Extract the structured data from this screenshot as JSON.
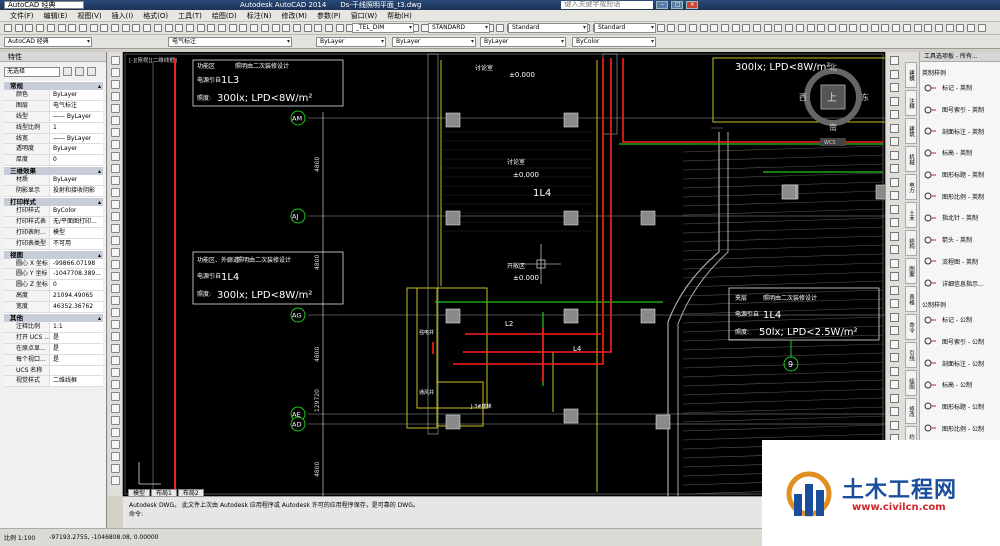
{
  "window": {
    "workspace": "AutoCAD 经典",
    "app_title": "Autodesk AutoCAD 2014",
    "file_title": "Ds-干线照明平面_t3.dwg",
    "search_placeholder": "键入关键字或短语"
  },
  "menu": [
    "文件(F)",
    "编辑(E)",
    "视图(V)",
    "插入(I)",
    "格式(O)",
    "工具(T)",
    "绘图(D)",
    "标注(N)",
    "修改(M)",
    "参数(P)",
    "窗口(W)",
    "帮助(H)"
  ],
  "toolbar": {
    "workspace_combo": "AutoCAD 经典",
    "layer_combo": "电气标注",
    "bylayer_combo": "ByLayer",
    "linetype_combo": "ByLayer",
    "lineweight_combo": "ByLayer",
    "plotstyle_combo": "ByColor",
    "dimstyle_combo": "_TEL_DIM",
    "textstyle_combo": "STANDARD",
    "tablestyle_combo": "Standard",
    "mleader_combo": "Standard"
  },
  "properties": {
    "title": "特性",
    "selection": "无选择",
    "sections": [
      {
        "name": "常规",
        "rows": [
          [
            "颜色",
            "ByLayer"
          ],
          [
            "图层",
            "电气标注"
          ],
          [
            "线型",
            "—— ByLayer"
          ],
          [
            "线型比例",
            "1"
          ],
          [
            "线宽",
            "—— ByLayer"
          ],
          [
            "透明度",
            "ByLayer"
          ],
          [
            "厚度",
            "0"
          ]
        ]
      },
      {
        "name": "三维效果",
        "rows": [
          [
            "材质",
            "ByLayer"
          ],
          [
            "阴影显示",
            "投射和接收阴影"
          ]
        ]
      },
      {
        "name": "打印样式",
        "rows": [
          [
            "打印样式",
            "ByColor"
          ],
          [
            "打印样式表",
            "无/平面图打印..."
          ],
          [
            "打印表附...",
            "模型"
          ],
          [
            "打印表类型",
            "不可用"
          ]
        ]
      },
      {
        "name": "视图",
        "rows": [
          [
            "圆心 X 坐标",
            "-99866.07198"
          ],
          [
            "圆心 Y 坐标",
            "-1047708.389..."
          ],
          [
            "圆心 Z 坐标",
            "0"
          ],
          [
            "高度",
            "21094.49065"
          ],
          [
            "宽度",
            "46352.36762"
          ]
        ]
      },
      {
        "name": "其他",
        "rows": [
          [
            "注释比例",
            "1:1"
          ],
          [
            "打开 UCS ...",
            "是"
          ],
          [
            "在原点显...",
            "是"
          ],
          [
            "每个视口...",
            "是"
          ],
          [
            "UCS 名称",
            ""
          ],
          [
            "视觉样式",
            "二维线框"
          ]
        ]
      }
    ]
  },
  "drawing": {
    "viewport_label": "[-][俯视][二维线框]",
    "axes": [
      "AM",
      "AJ",
      "AG",
      "AE",
      "AD"
    ],
    "dims": [
      "4800",
      "4800",
      "4800",
      "129720",
      "4800"
    ],
    "notes": {
      "block1": {
        "l1": "功能区",
        "l2": "照明由二次装修设计",
        "l3": "电源引自",
        "l4": "1L3",
        "l5": "照度:",
        "l6": "300lx; LPD<8W/m²"
      },
      "block2": {
        "l1": "功能区、外廊道",
        "l2": "照明由二次装修设计",
        "l3": "电源引自",
        "l4": "1L4",
        "l5": "照度:",
        "l6": "300lx; LPD<8W/m²"
      },
      "block3": {
        "l1": "夹层",
        "l2": "照明由二次装修设计",
        "l3": "电源引自",
        "l4": "1L4",
        "l5": "照度:",
        "l6": "50lx; LPD<2.5W/m²"
      },
      "top_right": "300lx; LPD<8W/m²"
    },
    "elevations": [
      "讨论室",
      "±0.000",
      "讨论室",
      "±0.000",
      "开敞区",
      "±0.000"
    ],
    "labels": {
      "circuit1": "1L4",
      "l2": "L2",
      "l4": "L4",
      "room1": "强电井",
      "room2": "通风井",
      "room3": "J-3#楼梯"
    },
    "compass": {
      "n": "北",
      "s": "南",
      "e": "东",
      "w": "西",
      "center": "上"
    },
    "wcs": "WCS",
    "axis_9": "9"
  },
  "tabs": [
    "模型",
    "布局1",
    "布局2"
  ],
  "command": {
    "line1": "Autodesk DWG。 此文件上次由 Autodesk 应用程序或 Autodesk 许可的应用程序保存，是可靠的 DWG。",
    "prompt": "命令:"
  },
  "status": {
    "scale": "比例 1:100",
    "coords": "-97193.2755, -1046808.08, 0.00000"
  },
  "palette": {
    "title": "工具选项板 - 所有...",
    "section1": "英制样例",
    "items1": [
      "标记 - 英制",
      "图号索引 - 英制",
      "剖面标注 - 英制",
      "标高 - 英制",
      "图形标题 - 英制",
      "图形比例 - 英制",
      "指北针 - 英制",
      "箭头 - 英制",
      "流程图 - 英制",
      "详细信息指示..."
    ],
    "section2": "公制样例",
    "items2": [
      "标记 - 公制",
      "图号索引 - 公制",
      "剖面标注 - 公制",
      "标高 - 公制",
      "图形标题 - 公制",
      "图形比例 - 公制",
      "指北针 - 公制",
      "箭头 - 公制"
    ],
    "tabs": [
      "建模",
      "注释",
      "建筑",
      "机械",
      "电力",
      "土木",
      "结构",
      "图案",
      "表格",
      "命令",
      "引线",
      "绘图",
      "修改",
      "约束",
      "视觉",
      "材质",
      "相机",
      "光源",
      "填充"
    ]
  },
  "watermark": {
    "title": "土木工程网",
    "url": "www.civilcn.com"
  }
}
